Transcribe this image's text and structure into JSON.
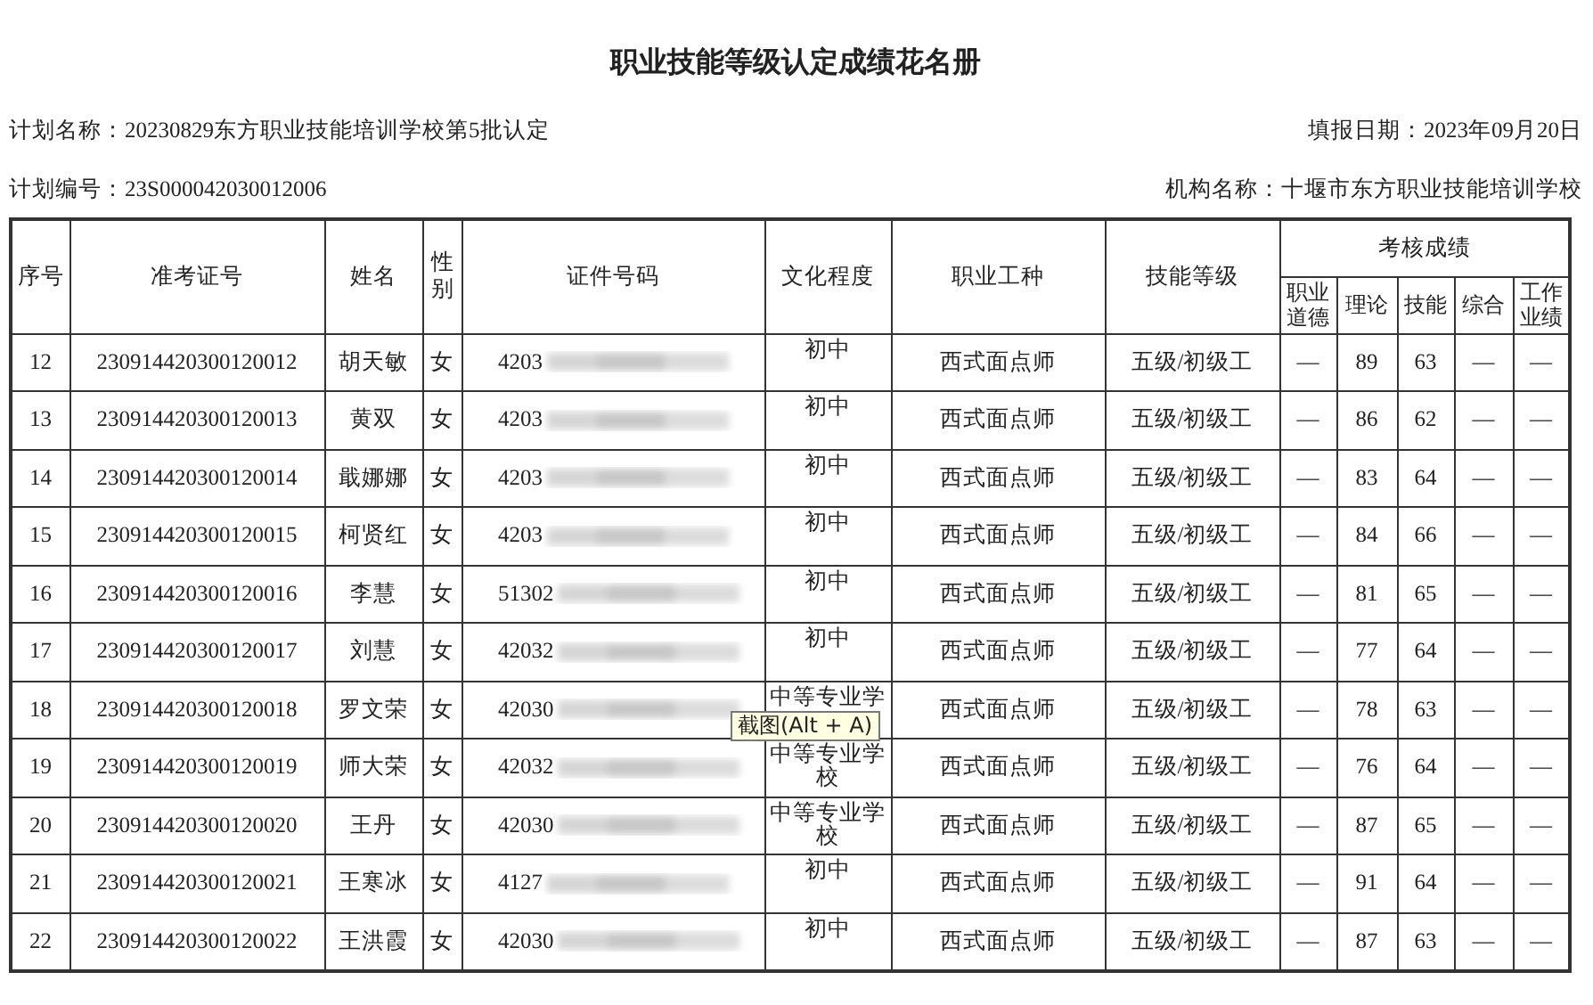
{
  "title": "职业技能等级认定成绩花名册",
  "meta": [
    {
      "label": "计划名称：",
      "value": "20230829东方职业技能培训学校第5批认定"
    },
    {
      "label": "填报日期：",
      "value": "2023年09月20日"
    },
    {
      "label": "计划编号：",
      "value": "23S000042030012006"
    },
    {
      "label": "机构名称：",
      "value": "十堰市东方职业技能培训学校"
    }
  ],
  "table": {
    "columns": [
      "序号",
      "准考证号",
      "姓名",
      "性别",
      "证件号码",
      "文化程度",
      "职业工种",
      "技能等级"
    ],
    "group_header": "考核成绩",
    "score_columns": [
      "职业道德",
      "理论",
      "技能",
      "综合",
      "工作业绩"
    ],
    "rows": [
      {
        "no": "12",
        "exam_no": "230914420300120012",
        "name": "胡天敏",
        "gender": "女",
        "id_number": "4203",
        "education": "初中",
        "occupation": "西式面点师",
        "level": "五级/初级工",
        "scores": [
          "—",
          "89",
          "63",
          "—",
          "—"
        ]
      },
      {
        "no": "13",
        "exam_no": "230914420300120013",
        "name": "黄双",
        "gender": "女",
        "id_number": "4203",
        "education": "初中",
        "occupation": "西式面点师",
        "level": "五级/初级工",
        "scores": [
          "—",
          "86",
          "62",
          "—",
          "—"
        ]
      },
      {
        "no": "14",
        "exam_no": "230914420300120014",
        "name": "戢娜娜",
        "gender": "女",
        "id_number": "4203",
        "education": "初中",
        "occupation": "西式面点师",
        "level": "五级/初级工",
        "scores": [
          "—",
          "83",
          "64",
          "—",
          "—"
        ]
      },
      {
        "no": "15",
        "exam_no": "230914420300120015",
        "name": "柯贤红",
        "gender": "女",
        "id_number": "4203",
        "education": "初中",
        "occupation": "西式面点师",
        "level": "五级/初级工",
        "scores": [
          "—",
          "84",
          "66",
          "—",
          "—"
        ]
      },
      {
        "no": "16",
        "exam_no": "230914420300120016",
        "name": "李慧",
        "gender": "女",
        "id_number": "51302",
        "education": "初中",
        "occupation": "西式面点师",
        "level": "五级/初级工",
        "scores": [
          "—",
          "81",
          "65",
          "—",
          "—"
        ]
      },
      {
        "no": "17",
        "exam_no": "230914420300120017",
        "name": "刘慧",
        "gender": "女",
        "id_number": "42032",
        "education": "初中",
        "occupation": "西式面点师",
        "level": "五级/初级工",
        "scores": [
          "—",
          "77",
          "64",
          "—",
          "—"
        ]
      },
      {
        "no": "18",
        "exam_no": "230914420300120018",
        "name": "罗文荣",
        "gender": "女",
        "id_number": "42030",
        "education": "中等专业学",
        "occupation": "西式面点师",
        "level": "五级/初级工",
        "scores": [
          "—",
          "78",
          "63",
          "—",
          "—"
        ]
      },
      {
        "no": "19",
        "exam_no": "230914420300120019",
        "name": "师大荣",
        "gender": "女",
        "id_number": "42032",
        "education": "中等专业学校",
        "occupation": "西式面点师",
        "level": "五级/初级工",
        "scores": [
          "—",
          "76",
          "64",
          "—",
          "—"
        ]
      },
      {
        "no": "20",
        "exam_no": "230914420300120020",
        "name": "王丹",
        "gender": "女",
        "id_number": "42030",
        "education": "中等专业学校",
        "occupation": "西式面点师",
        "level": "五级/初级工",
        "scores": [
          "—",
          "87",
          "65",
          "—",
          "—"
        ]
      },
      {
        "no": "21",
        "exam_no": "230914420300120021",
        "name": "王寒冰",
        "gender": "女",
        "id_number": "4127",
        "education": "初中",
        "occupation": "西式面点师",
        "level": "五级/初级工",
        "scores": [
          "—",
          "91",
          "64",
          "—",
          "—"
        ]
      },
      {
        "no": "22",
        "exam_no": "230914420300120022",
        "name": "王洪霞",
        "gender": "女",
        "id_number": "42030",
        "education": "初中",
        "occupation": "西式面点师",
        "level": "五级/初级工",
        "scores": [
          "—",
          "87",
          "63",
          "—",
          "—"
        ]
      }
    ]
  },
  "tooltip": {
    "text": "截图(Alt + A)"
  }
}
